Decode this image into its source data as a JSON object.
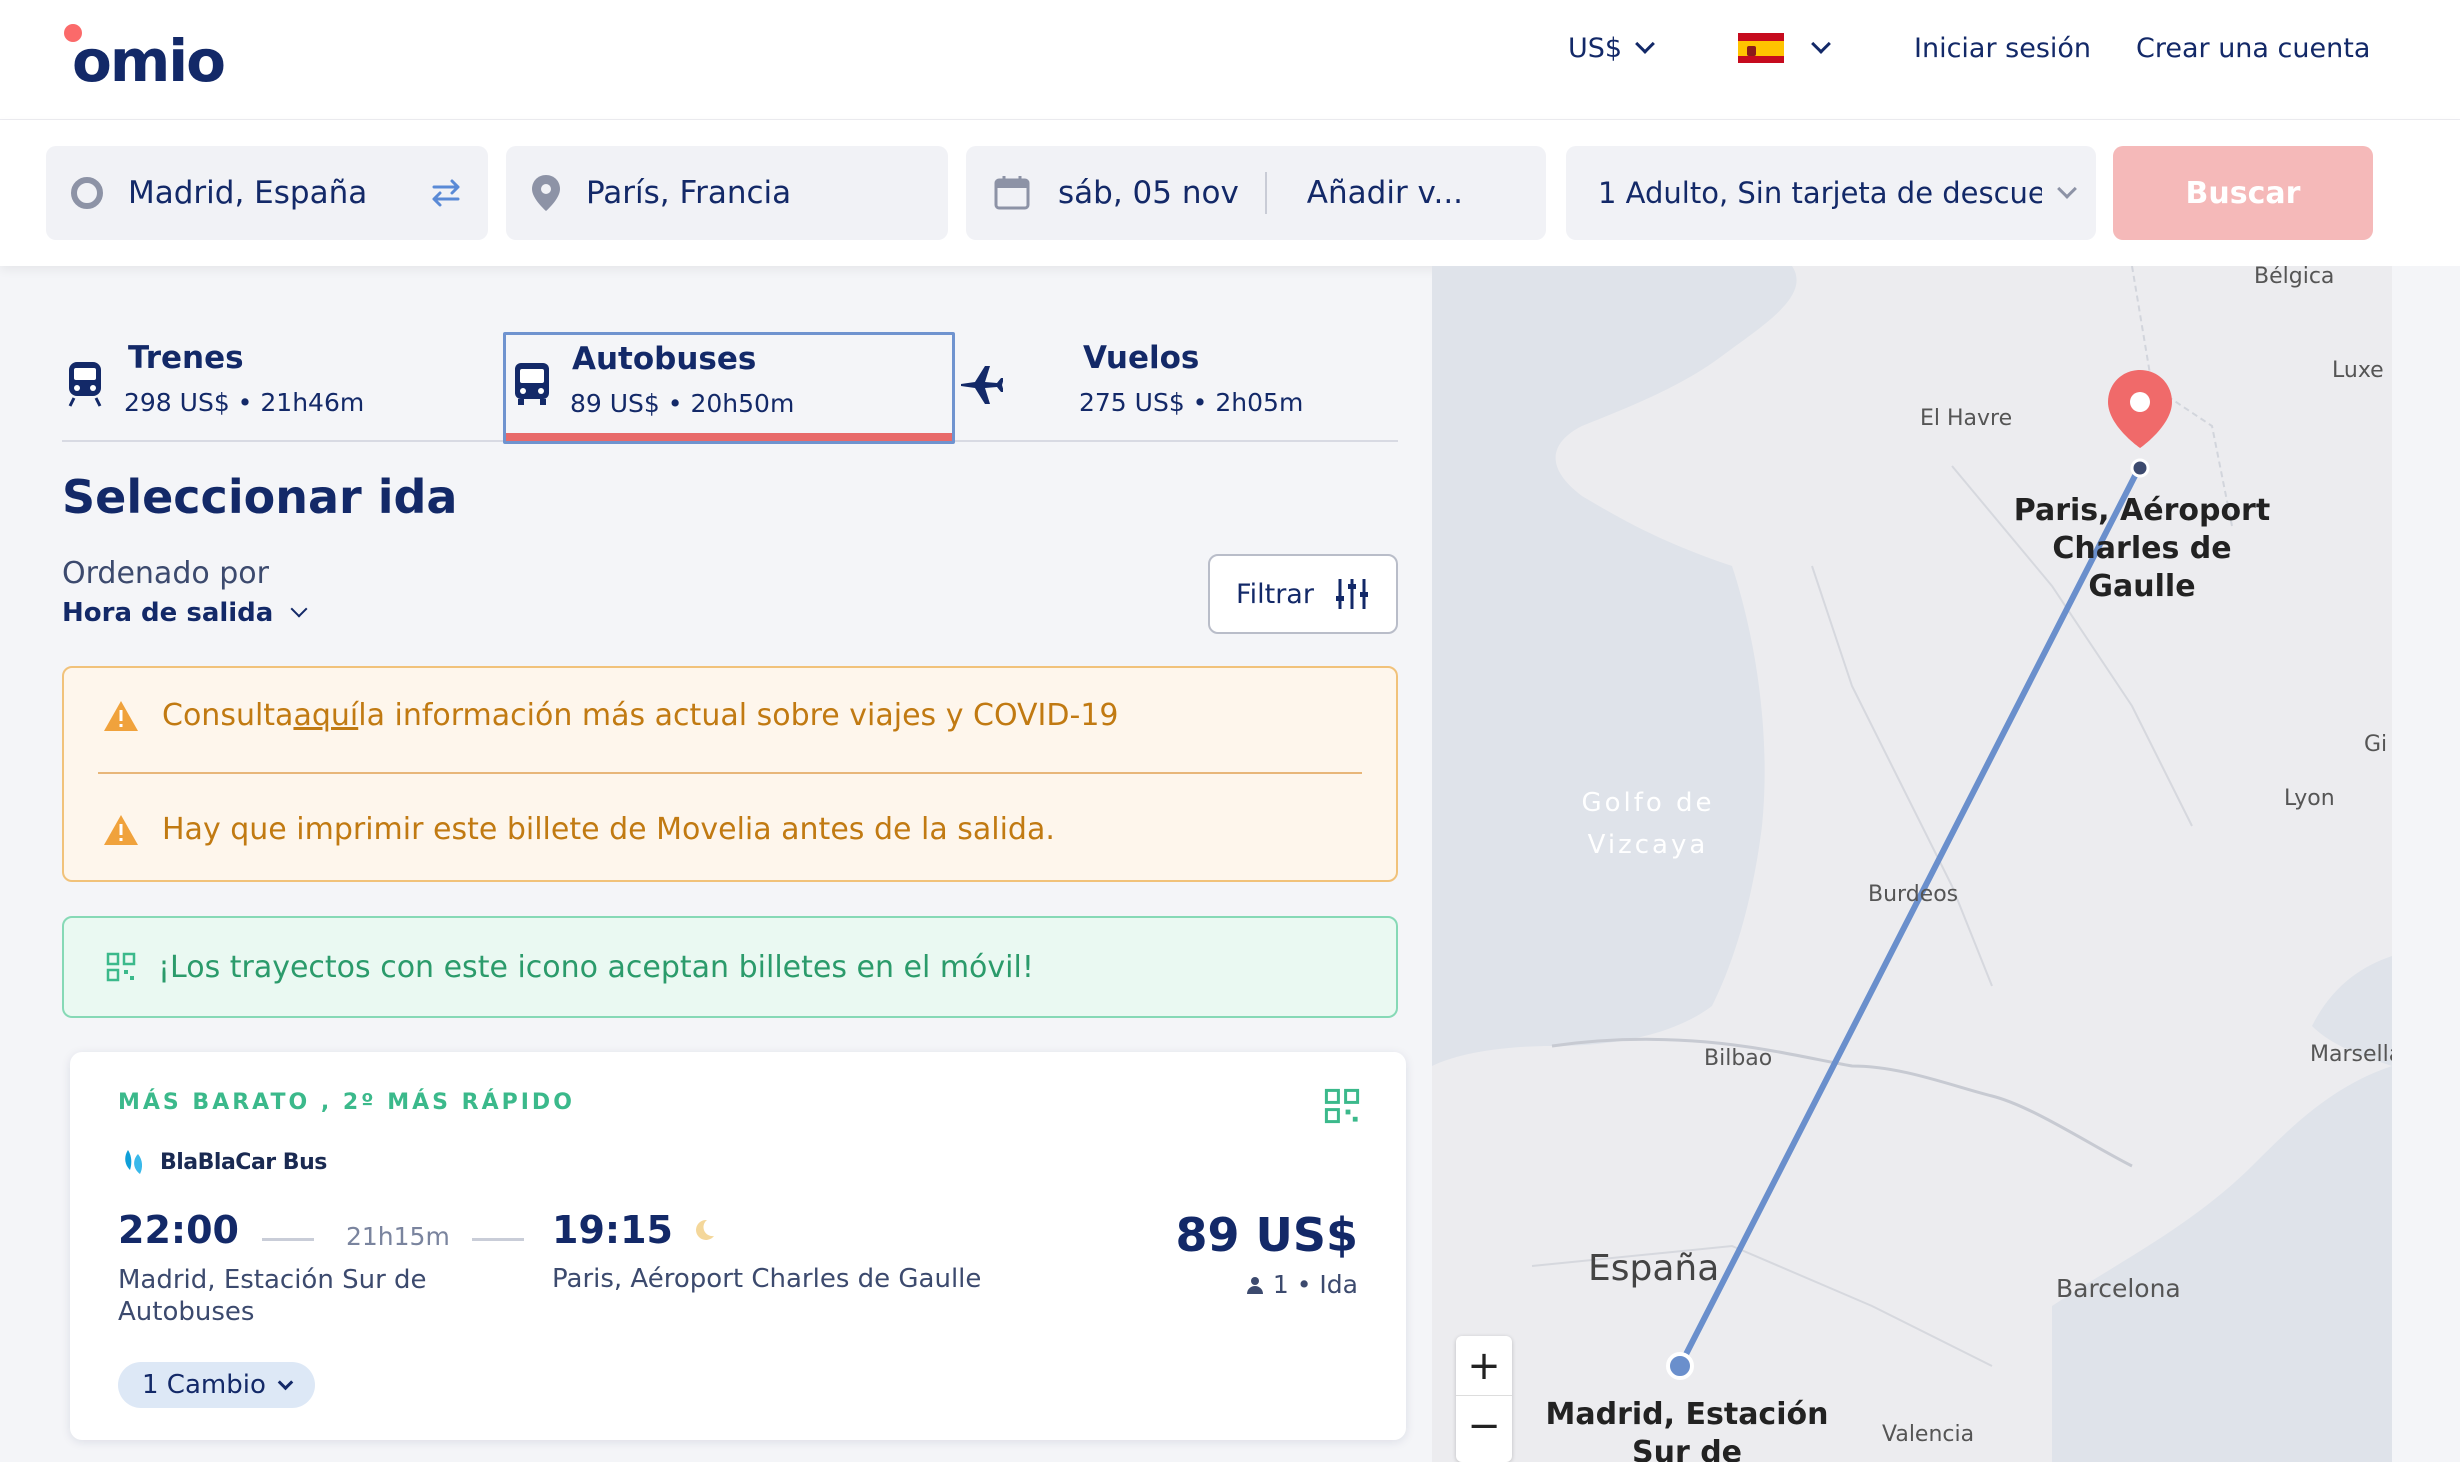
{
  "header": {
    "logo_text": "omio",
    "currency": "US$",
    "login": "Iniciar sesión",
    "signup": "Crear una cuenta"
  },
  "search": {
    "origin": "Madrid, España",
    "destination": "París, Francia",
    "date": "sáb, 05 nov",
    "return": "Añadir v...",
    "passengers": "1 Adulto, Sin tarjeta de descuen",
    "button": "Buscar"
  },
  "tabs": [
    {
      "name": "Trenes",
      "meta": "298 US$ • 21h46m",
      "icon": "train-icon"
    },
    {
      "name": "Autobuses",
      "meta": "89 US$ • 20h50m",
      "icon": "bus-icon"
    },
    {
      "name": "Vuelos",
      "meta": "275 US$ • 2h05m",
      "icon": "plane-icon"
    }
  ],
  "results": {
    "title": "Seleccionar ida",
    "sort_label": "Ordenado por",
    "sort_value": "Hora de salida",
    "filter_label": "Filtrar"
  },
  "notices": {
    "covid_prefix": "Consulta ",
    "covid_link": "aquí",
    "covid_suffix": " la información más actual sobre viajes y COVID-19",
    "print": "Hay que imprimir este billete de Movelia antes de la salida.",
    "mobile": "¡Los trayectos con este icono aceptan billetes en el móvil!"
  },
  "card": {
    "badge": "MÁS BARATO , 2º MÁS RÁPIDO",
    "provider": "BlaBlaCar Bus",
    "departure_time": "22:00",
    "duration": "21h15m",
    "arrival_time": "19:15",
    "departure_station": "Madrid, Estación Sur de Autobuses",
    "arrival_station": "Paris, Aéroport Charles de Gaulle",
    "price": "89 US$",
    "pax": "1 • Ida",
    "changes": "1 Cambio"
  },
  "map": {
    "labels": {
      "belgica": "Bélgica",
      "luxe": "Luxe",
      "elhavre": "El Havre",
      "paris": "Paris, Aéroport Charles de Gaulle",
      "golfo": "Golfo de Vizcaya",
      "burdeos": "Burdeos",
      "lyon": "Lyon",
      "gi": "Gi",
      "bilbao": "Bilbao",
      "marsella": "Marsella",
      "espana": "España",
      "barcelona": "Barcelona",
      "madrid": "Madrid, Estación Sur de Autobuses",
      "valencia": "Valencia"
    },
    "zoom_in": "+",
    "zoom_out": "−"
  },
  "colors": {
    "brand_navy": "#132968",
    "accent_red": "#fb6a6a",
    "search_button": "#f5b9b9",
    "route_line": "#6a8fcc",
    "warn": "#c17a12",
    "success": "#2b9b6b"
  }
}
